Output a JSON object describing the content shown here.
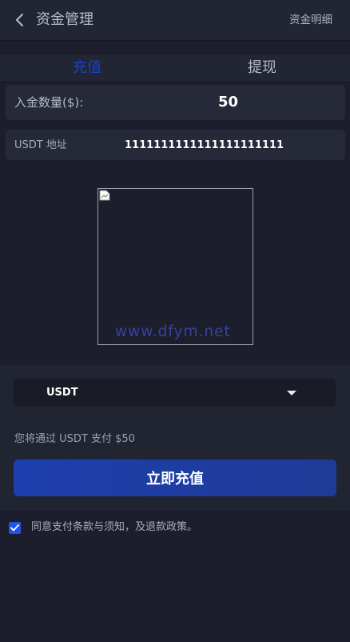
{
  "header": {
    "title": "资金管理",
    "detail_link": "资金明细"
  },
  "tabs": {
    "recharge": "充值",
    "withdraw": "提现",
    "active": "recharge"
  },
  "form": {
    "amount_label": "入金数量($):",
    "amount_value": "50",
    "address_label": "USDT 地址",
    "address_value": "1111111111111111111111"
  },
  "qr": {
    "watermark": "www.dfym.net"
  },
  "payment": {
    "selected_method": "USDT",
    "note": "您将通过 USDT 支付 $50",
    "submit_label": "立即充值"
  },
  "agreement": {
    "checked": true,
    "text": "同意支付条款与须知，及退款政策。"
  },
  "colors": {
    "background": "#1c1f2b",
    "accent": "#1b41c6",
    "button": "#1d3fae",
    "checkbox": "#2451e6"
  },
  "icons": [
    "chevron-left-icon",
    "broken-image-icon",
    "caret-down-icon",
    "check-icon"
  ]
}
